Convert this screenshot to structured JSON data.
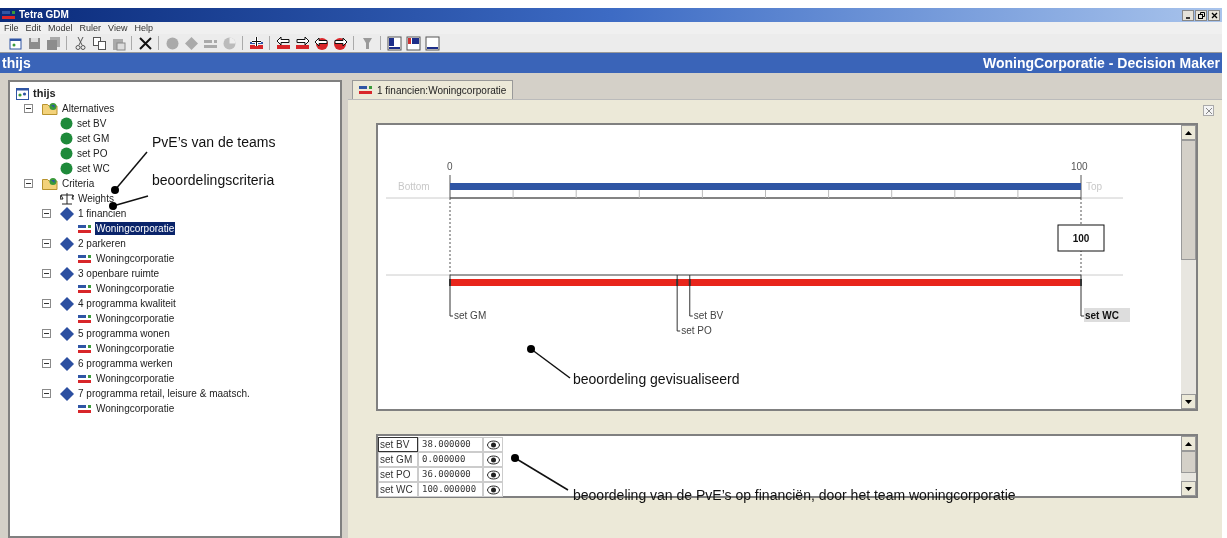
{
  "window": {
    "title": "Tetra GDM"
  },
  "menu": [
    "File",
    "Edit",
    "Model",
    "Ruler",
    "View",
    "Help"
  ],
  "header": {
    "project": "thijs",
    "title": "WoningCorporatie - Decision Maker"
  },
  "tree": {
    "label": "thijs",
    "selected": false,
    "children": [
      {
        "label": "Alternatives",
        "kind": "folder",
        "expanded": true,
        "selected": false,
        "children": [
          {
            "label": "set BV",
            "kind": "alternative",
            "selected": false
          },
          {
            "label": "set GM",
            "kind": "alternative",
            "selected": false
          },
          {
            "label": "set PO",
            "kind": "alternative",
            "selected": false
          },
          {
            "label": "set WC",
            "kind": "alternative",
            "selected": false
          }
        ]
      },
      {
        "label": "Criteria",
        "kind": "folder",
        "expanded": true,
        "selected": false,
        "children": [
          {
            "label": "Weights",
            "kind": "weights",
            "selected": false
          },
          {
            "label": "1 financien",
            "kind": "criterion",
            "expanded": true,
            "selected": false,
            "children": [
              {
                "label": "Woningcorporatie",
                "kind": "ruler",
                "selected": true
              }
            ]
          },
          {
            "label": "2 parkeren",
            "kind": "criterion",
            "expanded": true,
            "selected": false,
            "children": [
              {
                "label": "Woningcorporatie",
                "kind": "ruler",
                "selected": false
              }
            ]
          },
          {
            "label": "3 openbare ruimte",
            "kind": "criterion",
            "expanded": true,
            "selected": false,
            "children": [
              {
                "label": "Woningcorporatie",
                "kind": "ruler",
                "selected": false
              }
            ]
          },
          {
            "label": "4 programma kwaliteit",
            "kind": "criterion",
            "expanded": true,
            "selected": false,
            "children": [
              {
                "label": "Woningcorporatie",
                "kind": "ruler",
                "selected": false
              }
            ]
          },
          {
            "label": "5 programma wonen",
            "kind": "criterion",
            "expanded": true,
            "selected": false,
            "children": [
              {
                "label": "Woningcorporatie",
                "kind": "ruler",
                "selected": false
              }
            ]
          },
          {
            "label": "6 programma werken",
            "kind": "criterion",
            "expanded": true,
            "selected": false,
            "children": [
              {
                "label": "Woningcorporatie",
                "kind": "ruler",
                "selected": false
              }
            ]
          },
          {
            "label": "7 programma retail, leisure & maatsch.",
            "kind": "criterion",
            "expanded": true,
            "selected": false,
            "children": [
              {
                "label": "Woningcorporatie",
                "kind": "ruler",
                "selected": false
              }
            ]
          }
        ]
      }
    ]
  },
  "tabs": [
    {
      "label": "1 financien:Woningcorporatie",
      "selected": true
    }
  ],
  "ruler": {
    "min_label": "0",
    "max_label": "100",
    "bottom_label": "Bottom",
    "top_label": "Top",
    "weight_bar": {
      "level": 1,
      "value": "100"
    },
    "markers": [
      {
        "label": "set GM",
        "level": 0,
        "selected": false
      },
      {
        "label": "set PO",
        "level": 0.36,
        "selected": false
      },
      {
        "label": "set BV",
        "level": 0.38,
        "selected": false
      },
      {
        "label": "set WC",
        "level": 1,
        "selected": true
      }
    ]
  },
  "table": {
    "rows": [
      {
        "name": "set BV",
        "value": "38.000000",
        "selected": true
      },
      {
        "name": "set GM",
        "value": "0.000000",
        "selected": false
      },
      {
        "name": "set PO",
        "value": "36.000000",
        "selected": false
      },
      {
        "name": "set WC",
        "value": "100.000000",
        "selected": false
      }
    ]
  },
  "annotations": [
    {
      "text": "PvE’s van de teams"
    },
    {
      "text": "beoordelingscriteria"
    },
    {
      "text": "beoordeling gevisualiseerd"
    },
    {
      "text": "beoordeling van de PvE’s op financiën, door het team woningcorporatie"
    }
  ]
}
